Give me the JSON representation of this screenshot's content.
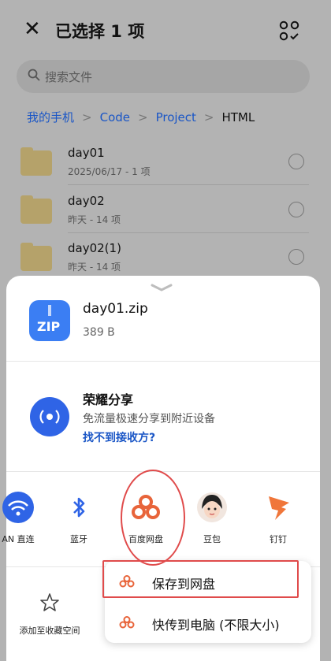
{
  "header": {
    "title": "已选择 1 项"
  },
  "search": {
    "placeholder": "搜索文件"
  },
  "breadcrumb": [
    "我的手机",
    "Code",
    "Project",
    "HTML"
  ],
  "files": [
    {
      "name": "day01",
      "meta": "2025/06/17 - 1 项"
    },
    {
      "name": "day02",
      "meta": "昨天 - 14 项"
    },
    {
      "name": "day02(1)",
      "meta": "昨天 - 14 项"
    }
  ],
  "sheet": {
    "file": {
      "icon_text": "ZIP",
      "name": "day01.zip",
      "size": "389 B"
    },
    "honor_share": {
      "title": "荣耀分享",
      "desc": "免流量极速分享到附近设备",
      "link": "找不到接收方?"
    },
    "apps": [
      {
        "label": "AN 直连",
        "icon": "wlan-direct-icon"
      },
      {
        "label": "蓝牙",
        "icon": "bluetooth-icon"
      },
      {
        "label": "百度网盘",
        "icon": "baidu-netdisk-icon"
      },
      {
        "label": "豆包",
        "icon": "doubao-icon"
      },
      {
        "label": "钉钉",
        "icon": "dingtalk-icon"
      }
    ],
    "favorite": {
      "label": "添加至收藏空间"
    },
    "popup": [
      {
        "label": "保存到网盘"
      },
      {
        "label": "快传到电脑 (不限大小)"
      }
    ]
  },
  "colors": {
    "accent": "#1a56c6",
    "highlight": "#e04b4b",
    "baidu": "#e8643a"
  }
}
